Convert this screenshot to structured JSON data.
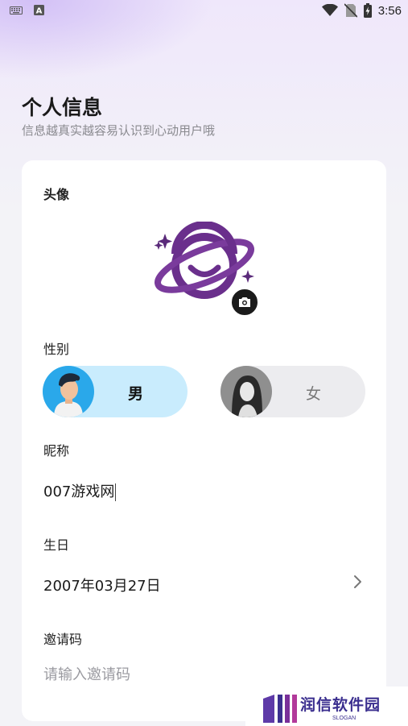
{
  "status_bar": {
    "time": "3:56",
    "left_icons": [
      "keyboard-icon",
      "font-a-icon"
    ],
    "right_icons": [
      "wifi-icon",
      "no-sim-icon",
      "battery-charging-icon"
    ]
  },
  "header": {
    "title": "个人信息",
    "subtitle": "信息越真实越容易认识到心动用户哦"
  },
  "form": {
    "avatar": {
      "label": "头像",
      "icon": "planet-smile-logo",
      "edit_icon": "camera-icon"
    },
    "gender": {
      "label": "性别",
      "options": [
        {
          "label": "男",
          "selected": true,
          "color": "#c9ecfd"
        },
        {
          "label": "女",
          "selected": false,
          "color": "#ececef"
        }
      ]
    },
    "nickname": {
      "label": "昵称",
      "value": "007游戏网"
    },
    "birthday": {
      "label": "生日",
      "value": "2007年03月27日",
      "icon": "chevron-right-icon"
    },
    "invite_code": {
      "label": "邀请码",
      "placeholder": "请输入邀请码",
      "value": ""
    }
  },
  "watermark": {
    "text": "润信软件园",
    "sub": "SLOGAN"
  },
  "colors": {
    "accent_purple": "#6a2f8c",
    "male_bg": "#c9ecfd",
    "female_bg": "#ececef"
  }
}
